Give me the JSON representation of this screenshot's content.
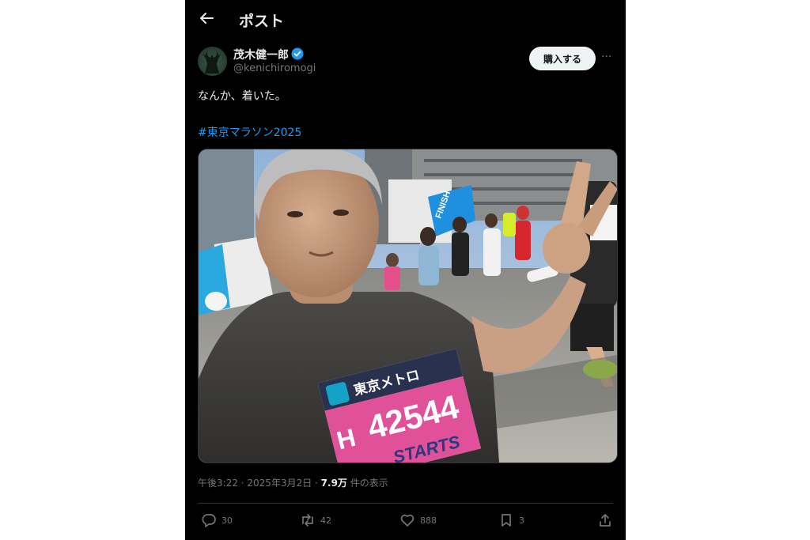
{
  "header": {
    "title": "ポスト",
    "back_icon": "arrow-left-icon"
  },
  "user": {
    "name": "茂木健一郎",
    "handle": "@kenichiromogi",
    "verified": true,
    "accent": "#1d9bf0"
  },
  "buttons": {
    "buy_label": "購入する",
    "more_label": "···"
  },
  "post": {
    "text": "なんか、着いた。",
    "hashtag": "#東京マラソン2025"
  },
  "photo": {
    "bib_sponsor": "東京メトロ",
    "bib_number": "42544",
    "bib_letter": "H",
    "bib_footer": "STARTS",
    "banner_text": "FINISH"
  },
  "meta": {
    "time": "午後3:22",
    "date": "2025年3月2日",
    "views": "7.9万",
    "views_suffix": "件の表示"
  },
  "actions": {
    "replies": "30",
    "reposts": "42",
    "likes": "888",
    "bookmarks": "3"
  }
}
